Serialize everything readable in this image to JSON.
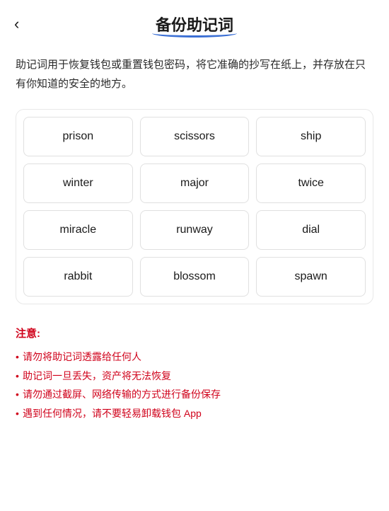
{
  "header": {
    "back_icon": "‹",
    "title": "备份助记词",
    "title_underline": true
  },
  "description": "助记词用于恢复钱包或重置钱包密码，将它准确的抄写在纸上，并存放在只有你知道的安全的地方。",
  "mnemonic": {
    "words": [
      "prison",
      "scissors",
      "ship",
      "winter",
      "major",
      "twice",
      "miracle",
      "runway",
      "dial",
      "rabbit",
      "blossom",
      "spawn"
    ]
  },
  "notes": {
    "title": "注意:",
    "items": [
      "请勿将助记词透露给任何人",
      "助记词一旦丢失，资产将无法恢复",
      "请勿通过截屏、网络传输的方式进行备份保存",
      "遇到任何情况，请不要轻易卸载钱包 App"
    ]
  }
}
